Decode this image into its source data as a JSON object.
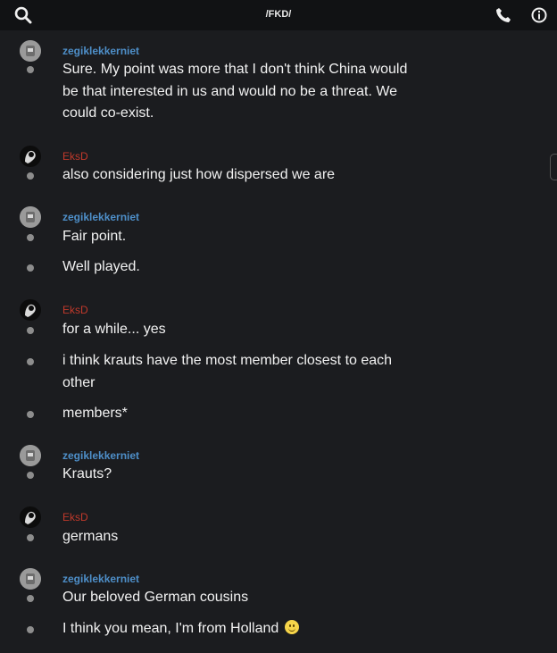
{
  "header": {
    "title": "/FKD/",
    "search_icon": "search-icon",
    "call_icon": "phone-icon",
    "info_icon": "info-icon"
  },
  "colors": {
    "background": "#1b1c1f",
    "header": "#111214",
    "user_zegik": "#4e8fc9",
    "user_eksd": "#c0392b",
    "text": "#f2f2f2"
  },
  "messages": [
    {
      "user": "zegiklekkerniet",
      "lines": [
        "Sure. My point was more that I don't think China would be that interested in us and would no be a threat. We could co-exist."
      ]
    },
    {
      "user": "EksD",
      "lines": [
        "also considering just how dispersed we are"
      ]
    },
    {
      "user": "zegiklekkerniet",
      "lines": [
        "Fair point.",
        "Well played."
      ]
    },
    {
      "user": "EksD",
      "lines": [
        "for a while... yes",
        "i think krauts have the most member closest to each other",
        "members*"
      ]
    },
    {
      "user": "zegiklekkerniet",
      "lines": [
        "Krauts?"
      ]
    },
    {
      "user": "EksD",
      "lines": [
        "germans"
      ]
    },
    {
      "user": "zegiklekkerniet",
      "lines": [
        "Our beloved German cousins",
        "I think you mean, I'm from Holland"
      ]
    }
  ]
}
